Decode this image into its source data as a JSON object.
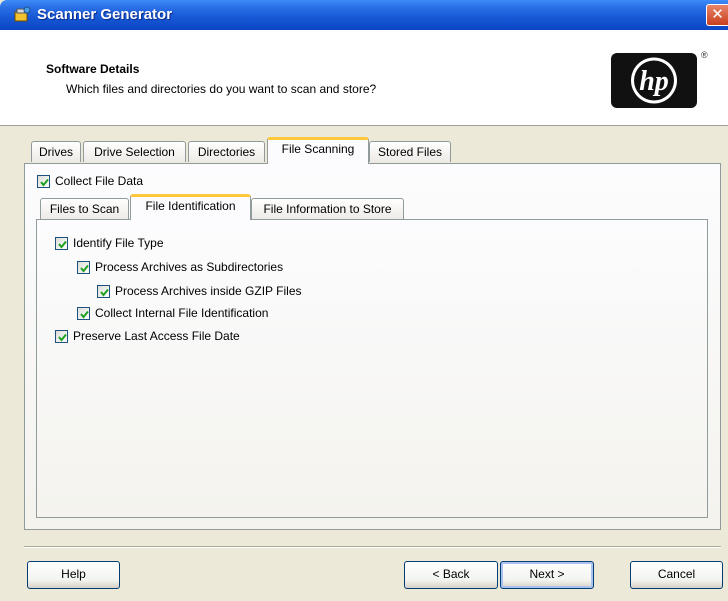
{
  "window": {
    "title": "Scanner Generator",
    "close_glyph": "✕"
  },
  "header": {
    "title": "Software Details",
    "subtitle": "Which files and directories do you want to scan and store?",
    "logo_text": "hp",
    "logo_mark": "®"
  },
  "main_tabs": [
    {
      "label": "Drives",
      "active": false
    },
    {
      "label": "Drive Selection",
      "active": false
    },
    {
      "label": "Directories",
      "active": false
    },
    {
      "label": "File Scanning",
      "active": true
    },
    {
      "label": "Stored Files",
      "active": false
    }
  ],
  "collect_file_data": {
    "label": "Collect File Data",
    "checked": true
  },
  "sub_tabs": [
    {
      "label": "Files to Scan",
      "active": false
    },
    {
      "label": "File Identification",
      "active": true
    },
    {
      "label": "File Information to Store",
      "active": false
    }
  ],
  "options": [
    {
      "label": "Identify File Type",
      "checked": true
    },
    {
      "label": "Process Archives as Subdirectories",
      "checked": true
    },
    {
      "label": "Process Archives inside GZIP Files",
      "checked": true
    },
    {
      "label": "Collect Internal File Identification",
      "checked": true
    },
    {
      "label": "Preserve Last Access File Date",
      "checked": true
    }
  ],
  "buttons": {
    "help": "Help",
    "back": "< Back",
    "next": "Next >",
    "cancel": "Cancel"
  },
  "colors": {
    "titlebar": "#0a46c4",
    "active_tab_accent": "#ffc83c",
    "checkmark": "#21a121"
  }
}
